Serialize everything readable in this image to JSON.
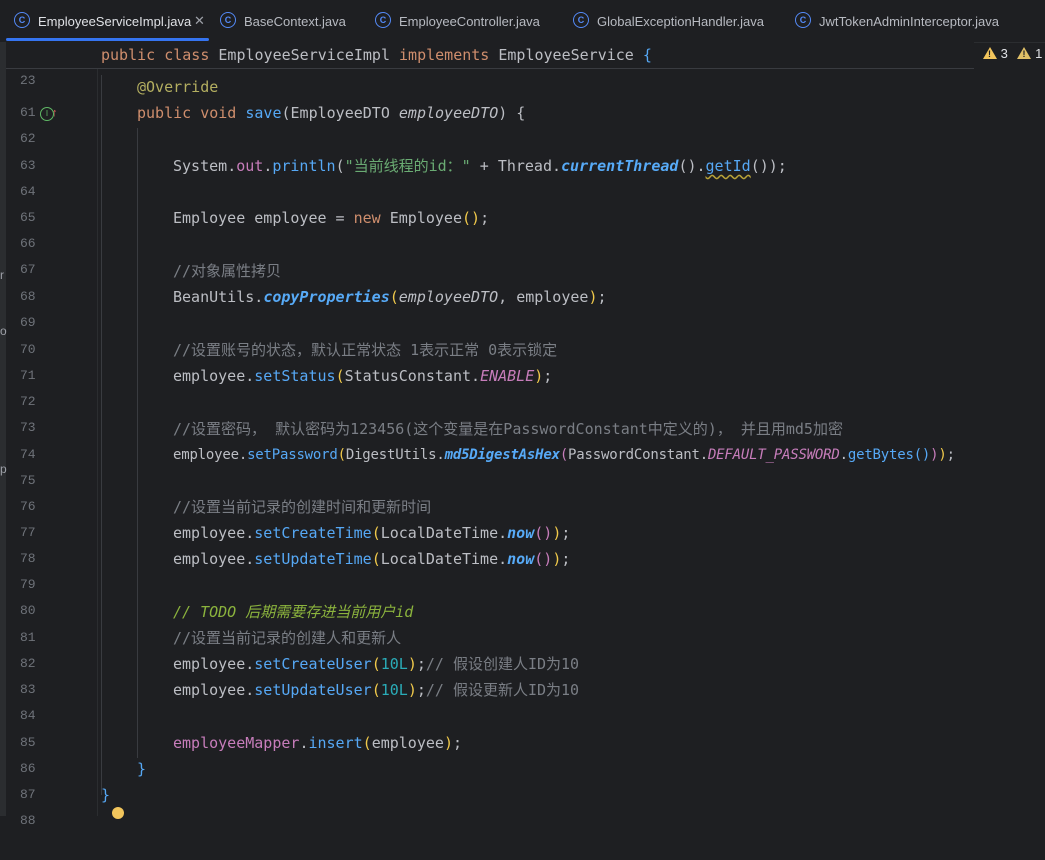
{
  "tabs": [
    {
      "label": "EmployeeServiceImpl.java",
      "icon": "class-icon",
      "active": true
    },
    {
      "label": "BaseContext.java",
      "icon": "class-icon"
    },
    {
      "label": "EmployeeController.java",
      "icon": "class-icon"
    },
    {
      "label": "GlobalExceptionHandler.java",
      "icon": "class-icon"
    },
    {
      "label": "JwtTokenAdminInterceptor.java",
      "icon": "class-icon"
    }
  ],
  "close_glyph": "✕",
  "inspections": {
    "warnings": "3",
    "weak_warnings": "1"
  },
  "sticky": {
    "line_number": "23",
    "kw1": "public",
    "kw2": "class",
    "name": "EmployeeServiceImpl",
    "kw3": "implements",
    "iface": "EmployeeService",
    "brace": "{"
  },
  "left_strip": [
    "r",
    "o",
    "p"
  ],
  "lines": {
    "n61": "61",
    "n62": "62",
    "n63": "63",
    "n64": "64",
    "n65": "65",
    "n66": "66",
    "n67": "67",
    "n68": "68",
    "n69": "69",
    "n70": "70",
    "n71": "71",
    "n72": "72",
    "n73": "73",
    "n74": "74",
    "n75": "75",
    "n76": "76",
    "n77": "77",
    "n78": "78",
    "n79": "79",
    "n80": "80",
    "n81": "81",
    "n82": "82",
    "n83": "83",
    "n84": "84",
    "n85": "85",
    "n86": "86",
    "n87": "87",
    "n88": "88"
  },
  "code": {
    "l61": "@Override",
    "l62_public": "public",
    "l62_void": "void",
    "l62_name": "save",
    "l62_ptype": "EmployeeDTO",
    "l62_pname": "employeeDTO",
    "l64_sys": "System",
    "l64_out": "out",
    "l64_println": "println",
    "l64_str": "\"当前线程的id：\"",
    "l64_thread": "Thread",
    "l64_ct": "currentThread",
    "l64_getid": "getId",
    "l66_type": "Employee",
    "l66_var": "employee",
    "l66_new": "new",
    "l66_ctor": "Employee",
    "l68": "//对象属性拷贝",
    "l69_cls": "BeanUtils",
    "l69_m": "copyProperties",
    "l69_a1": "employeeDTO",
    "l69_a2": "employee",
    "l71": "//设置账号的状态，默认正常状态 1表示正常 0表示锁定",
    "l72_obj": "employee",
    "l72_m": "setStatus",
    "l72_cls": "StatusConstant",
    "l72_f": "ENABLE",
    "l74": "//设置密码， 默认密码为123456(这个变量是在PasswordConstant中定义的)， 并且用md5加密",
    "l75_obj": "employee",
    "l75_m": "setPassword",
    "l75_cls": "DigestUtils",
    "l75_m2": "md5DigestAsHex",
    "l75_cls2": "PasswordConstant",
    "l75_f": "DEFAULT_PASSWORD",
    "l75_m3": "getBytes",
    "l77": "//设置当前记录的创建时间和更新时间",
    "l78_obj": "employee",
    "l78_m": "setCreateTime",
    "l78_cls": "LocalDateTime",
    "l78_now": "now",
    "l79_obj": "employee",
    "l79_m": "setUpdateTime",
    "l79_cls": "LocalDateTime",
    "l79_now": "now",
    "l81_pre": "// ",
    "l81_todo": "TODO 后期需要存进当前用户id",
    "l82": "//设置当前记录的创建人和更新人",
    "l83_obj": "employee",
    "l83_m": "setCreateUser",
    "l83_num": "10L",
    "l83_cmt": "// 假设创建人ID为10",
    "l84_obj": "employee",
    "l84_m": "setUpdateUser",
    "l84_num": "10L",
    "l84_cmt": "// 假设更新人ID为10",
    "l86_f": "employeeMapper",
    "l86_m": "insert",
    "l86_arg": "employee",
    "l87": "}",
    "l88": "}"
  }
}
